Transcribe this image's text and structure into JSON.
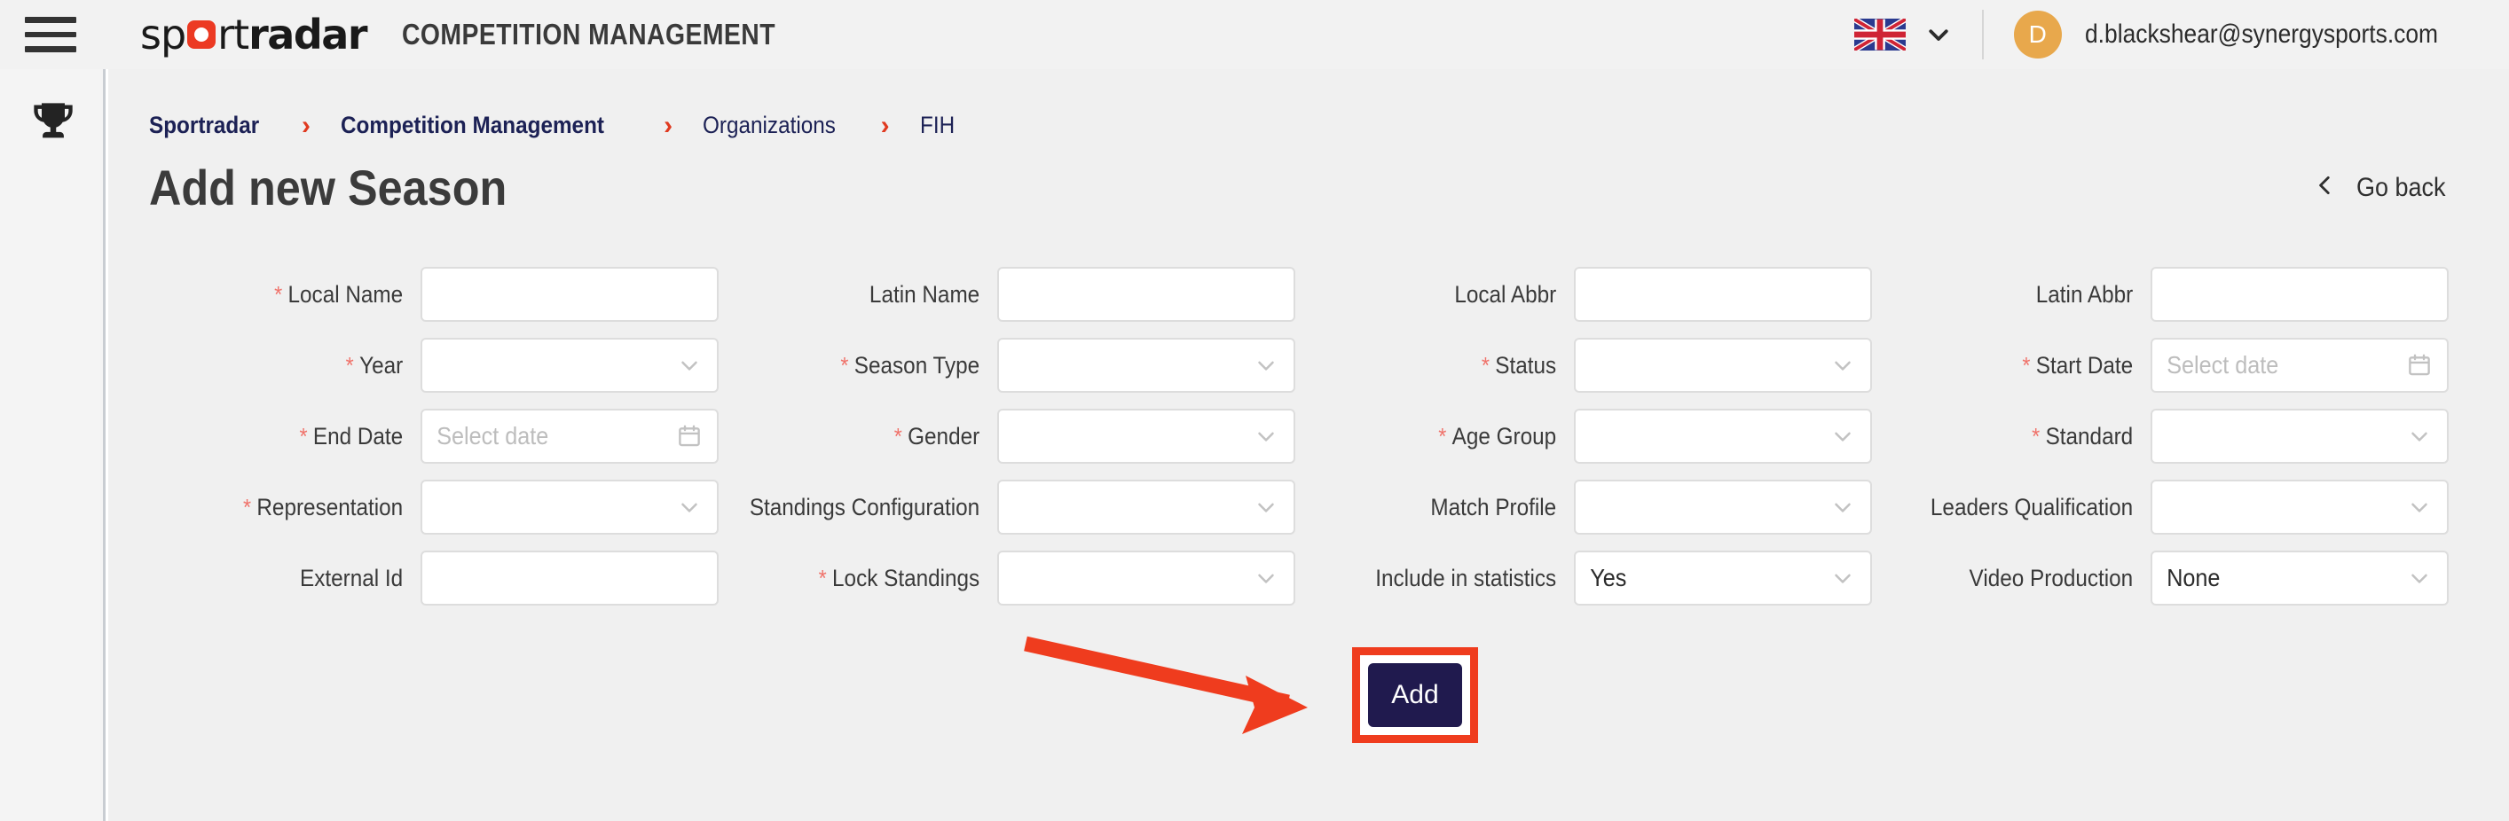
{
  "header": {
    "menu_icon": "hamburger-icon",
    "logo": {
      "part1": "sp",
      "part2": "rt",
      "part3": "radar"
    },
    "app_title": "COMPETITION MANAGEMENT",
    "language": {
      "flag": "uk-flag-icon",
      "chevron": "chevron-down-icon"
    },
    "user": {
      "avatar_initial": "D",
      "email": "d.blackshear@synergysports.com"
    },
    "bg_color": "#f2f2f2"
  },
  "sidebar": {
    "items": [
      {
        "icon": "trophy-icon",
        "name": "competitions"
      }
    ]
  },
  "breadcrumb": {
    "separator": "›",
    "items": [
      {
        "label": "Sportradar",
        "bold": true
      },
      {
        "label": "Competition Management",
        "bold": true
      },
      {
        "label": "Organizations",
        "bold": false
      },
      {
        "label": "FIH",
        "bold": false
      }
    ]
  },
  "page": {
    "title": "Add new Season",
    "go_back_label": "Go back",
    "go_back_icon": "chevron-left-icon"
  },
  "form": {
    "rows": [
      [
        {
          "label": "Local Name",
          "required": true,
          "type": "text",
          "value": "",
          "placeholder": ""
        },
        {
          "label": "Latin Name",
          "required": false,
          "type": "text",
          "value": "",
          "placeholder": ""
        },
        {
          "label": "Local Abbr",
          "required": false,
          "type": "text",
          "value": "",
          "placeholder": ""
        },
        {
          "label": "Latin Abbr",
          "required": false,
          "type": "text",
          "value": "",
          "placeholder": ""
        }
      ],
      [
        {
          "label": "Year",
          "required": true,
          "type": "select",
          "value": "",
          "placeholder": ""
        },
        {
          "label": "Season Type",
          "required": true,
          "type": "select",
          "value": "",
          "placeholder": ""
        },
        {
          "label": "Status",
          "required": true,
          "type": "select",
          "value": "",
          "placeholder": ""
        },
        {
          "label": "Start Date",
          "required": true,
          "type": "date",
          "value": "",
          "placeholder": "Select date"
        }
      ],
      [
        {
          "label": "End Date",
          "required": true,
          "type": "date",
          "value": "",
          "placeholder": "Select date"
        },
        {
          "label": "Gender",
          "required": true,
          "type": "select",
          "value": "",
          "placeholder": ""
        },
        {
          "label": "Age Group",
          "required": true,
          "type": "select",
          "value": "",
          "placeholder": ""
        },
        {
          "label": "Standard",
          "required": true,
          "type": "select",
          "value": "",
          "placeholder": ""
        }
      ],
      [
        {
          "label": "Representation",
          "required": true,
          "type": "select",
          "value": "",
          "placeholder": ""
        },
        {
          "label": "Standings Configuration",
          "required": false,
          "type": "select",
          "value": "",
          "placeholder": ""
        },
        {
          "label": "Match Profile",
          "required": false,
          "type": "select",
          "value": "",
          "placeholder": ""
        },
        {
          "label": "Leaders Qualification",
          "required": false,
          "type": "select",
          "value": "",
          "placeholder": ""
        }
      ],
      [
        {
          "label": "External Id",
          "required": false,
          "type": "text",
          "value": "",
          "placeholder": ""
        },
        {
          "label": "Lock Standings",
          "required": true,
          "type": "select",
          "value": "",
          "placeholder": ""
        },
        {
          "label": "Include in statistics",
          "required": false,
          "type": "select",
          "value": "Yes",
          "placeholder": ""
        },
        {
          "label": "Video Production",
          "required": false,
          "type": "select",
          "value": "None",
          "placeholder": ""
        }
      ]
    ]
  },
  "submit": {
    "add_label": "Add",
    "highlight_color": "#ef3c1e",
    "button_color": "#201a4e",
    "annotation": "red-arrow-pointing-to-add-button"
  }
}
